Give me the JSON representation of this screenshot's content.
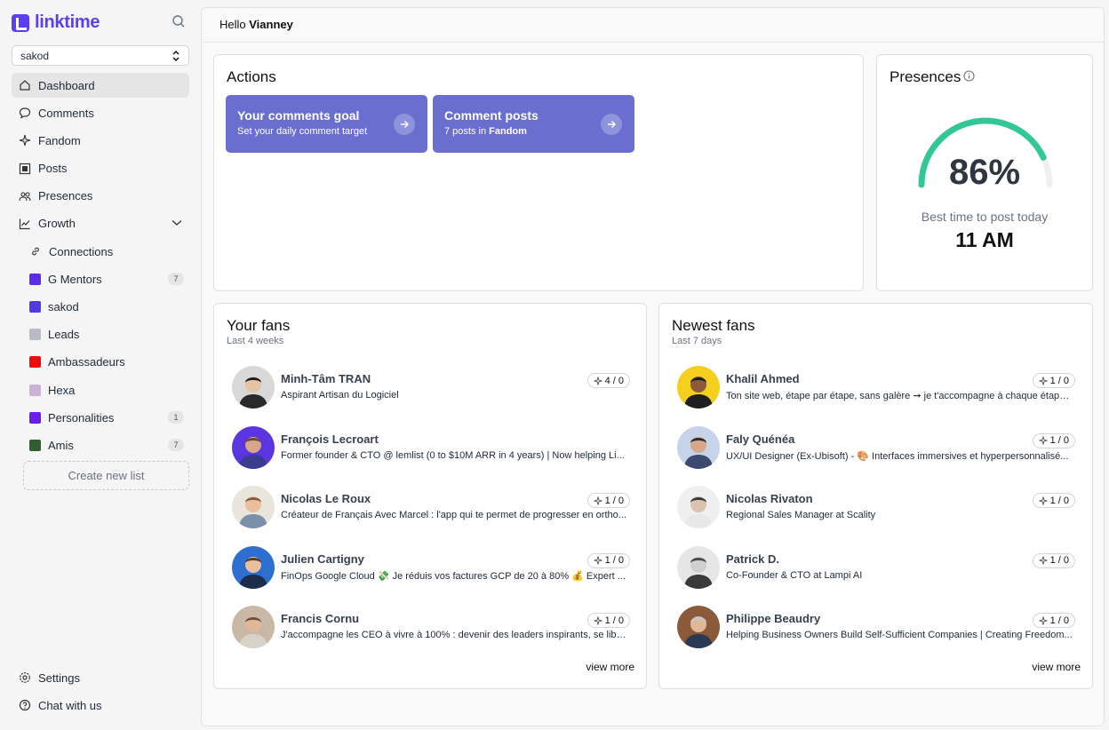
{
  "app": {
    "name": "linktime"
  },
  "workspace": {
    "selected": "sakod"
  },
  "nav": [
    {
      "label": "Dashboard",
      "icon": "home-icon",
      "active": true
    },
    {
      "label": "Comments",
      "icon": "comment-icon"
    },
    {
      "label": "Fandom",
      "icon": "sparkle-icon"
    },
    {
      "label": "Posts",
      "icon": "post-icon"
    },
    {
      "label": "Presences",
      "icon": "users-icon"
    },
    {
      "label": "Growth",
      "icon": "chart-icon"
    }
  ],
  "growth_sub": {
    "connections": "Connections"
  },
  "lists": [
    {
      "label": "G Mentors",
      "color": "#5b2ee6",
      "count": "7"
    },
    {
      "label": "sakod",
      "color": "#4f3ae6",
      "count": ""
    },
    {
      "label": "Leads",
      "color": "#b7bcc4",
      "count": ""
    },
    {
      "label": "Ambassadeurs",
      "color": "#f00a0a",
      "count": ""
    },
    {
      "label": "Hexa",
      "color": "#c8b3d6",
      "count": ""
    },
    {
      "label": "Personalities",
      "color": "#6a1df0",
      "count": "1"
    },
    {
      "label": "Amis",
      "color": "#2f5f2f",
      "count": "7"
    }
  ],
  "create_list": "Create new list",
  "bottom_nav": [
    {
      "label": "Settings",
      "icon": "gear-icon"
    },
    {
      "label": "Chat with us",
      "icon": "help-icon"
    }
  ],
  "header": {
    "hello": "Hello",
    "user": "Vianney"
  },
  "actions": {
    "title": "Actions",
    "items": [
      {
        "title": "Your comments goal",
        "subtitle": "Set your daily comment target",
        "subtitle_bold": ""
      },
      {
        "title": "Comment posts",
        "subtitle": "7 posts in",
        "subtitle_bold": "Fandom"
      }
    ]
  },
  "presences": {
    "title": "Presences",
    "value_percent": 86,
    "value_label": "86%",
    "best_label": "Best time to post today",
    "best_value": "11 AM",
    "gauge_color": "#34c796",
    "track_color": "#eef0f2"
  },
  "your_fans": {
    "title": "Your fans",
    "subtitle": "Last 4 weeks",
    "view_more": "view more",
    "items": [
      {
        "name": "Minh-Tâm TRAN",
        "desc": "Aspirant Artisan du Logiciel",
        "badge": "4 / 0",
        "bg": "#d8d8d8",
        "skin": "#e6c3a5",
        "hair": "#1b1b1b",
        "shirt": "#2a2a2a"
      },
      {
        "name": "François Lecroart",
        "desc": "Former founder & CTO @ lemlist (0 to $10M ARR in 4 years) | Now helping Li...",
        "badge": "",
        "bg": "#5b36e0",
        "skin": "#d6a88a",
        "hair": "#6b4a35",
        "shirt": "#3b3b8f"
      },
      {
        "name": "Nicolas Le Roux",
        "desc": "Créateur de Français Avec Marcel : l'app qui te permet de progresser en ortho...",
        "badge": "1 / 0",
        "bg": "#e9e4dc",
        "skin": "#e8c0a0",
        "hair": "#8a5a3a",
        "shirt": "#7a8fa8"
      },
      {
        "name": "Julien Cartigny",
        "desc": "FinOps Google Cloud 💸 Je réduis vos factures GCP de 20 à 80% 💰 Expert ...",
        "badge": "1 / 0",
        "bg": "#2c6fd1",
        "skin": "#e8c0a0",
        "hair": "#5a3a20",
        "shirt": "#1c2c4a"
      },
      {
        "name": "Francis Cornu",
        "desc": "J'accompagne les CEO à vivre à 100% : devenir des leaders inspirants, se libér...",
        "badge": "1 / 0",
        "bg": "#c9b8a6",
        "skin": "#e0b898",
        "hair": "#6e5040",
        "shirt": "#d9d2c8"
      }
    ]
  },
  "newest_fans": {
    "title": "Newest fans",
    "subtitle": "Last 7 days",
    "view_more": "view more",
    "items": [
      {
        "name": "Khalil Ahmed",
        "desc": "Ton site web, étape par étape, sans galère ➞ je t'accompagne à chaque étape ...",
        "badge": "1 / 0",
        "bg": "#f5cf1d",
        "skin": "#8a5a3a",
        "hair": "#1b1b1b",
        "shirt": "#1f1f1f"
      },
      {
        "name": "Faly Quénéa",
        "desc": "UX/UI Designer (Ex-Ubisoft) - 🎨 Interfaces immersives et hyperpersonnalisé...",
        "badge": "1 / 0",
        "bg": "#c7d3e8",
        "skin": "#d6a88a",
        "hair": "#2a2a35",
        "shirt": "#3b4a6e"
      },
      {
        "name": "Nicolas Rivaton",
        "desc": "Regional Sales Manager at Scality",
        "badge": "1 / 0",
        "bg": "#efefef",
        "skin": "#d9c4b4",
        "hair": "#3a3a3a",
        "shirt": "#e8e8e8"
      },
      {
        "name": "Patrick D.",
        "desc": "Co-Founder & CTO at Lampi AI",
        "badge": "1 / 0",
        "bg": "#e6e6e6",
        "skin": "#cfcfcf",
        "hair": "#4a4a4a",
        "shirt": "#3a3a3a"
      },
      {
        "name": "Philippe Beaudry",
        "desc": "Helping Business Owners Build Self-Sufficient Companies | Creating Freedom...",
        "badge": "1 / 0",
        "bg": "#8a5a3a",
        "skin": "#e0b898",
        "hair": "#c8c8c8",
        "shirt": "#2a3a55"
      }
    ]
  }
}
